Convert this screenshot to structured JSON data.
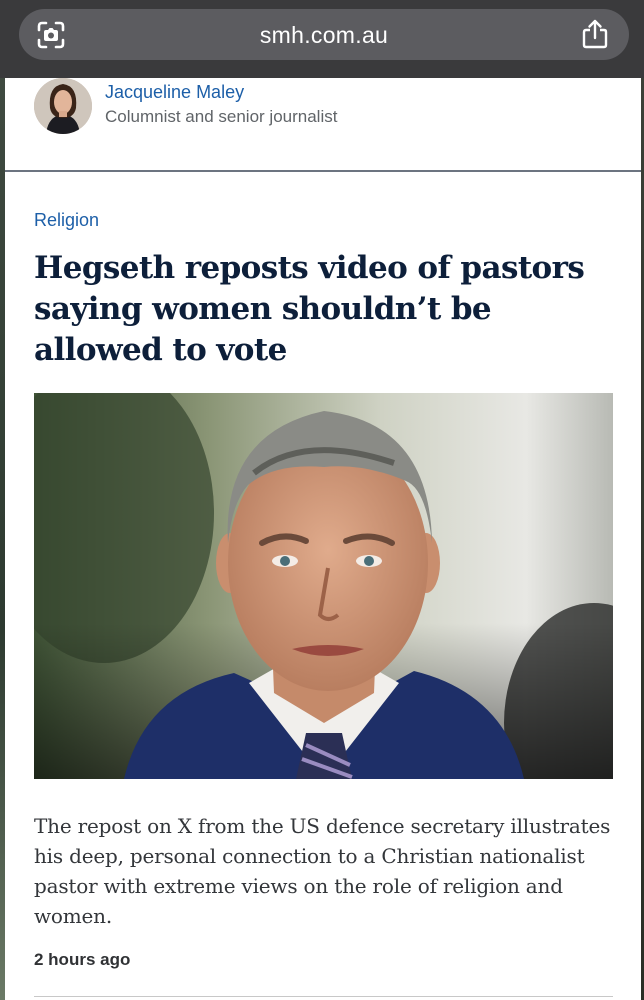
{
  "browser": {
    "url": "smh.com.au"
  },
  "author": {
    "name": "Jacqueline Maley",
    "role": "Columnist and senior journalist"
  },
  "article": {
    "section": "Religion",
    "headline": "Hegseth reposts video of pastors saying women shouldn’t be allowed to vote",
    "summary": "The repost on X from the US defence secretary illustrates his deep, personal connection to a Christian nationalist pastor with extreme views on the role of religion and women.",
    "timestamp": "2 hours ago"
  },
  "colors": {
    "link_blue": "#1d5fa8",
    "headline_navy": "#0d1f3a",
    "browser_bar": "#3a3a3c"
  },
  "icons": [
    "scan-icon",
    "share-icon"
  ]
}
